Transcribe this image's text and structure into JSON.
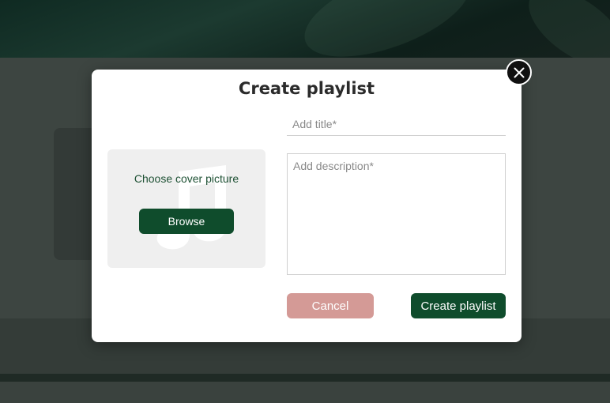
{
  "modal": {
    "title": "Create playlist",
    "cover": {
      "label": "Choose cover picture",
      "browse_label": "Browse",
      "icon": "music-note-icon"
    },
    "title_field": {
      "value": "",
      "placeholder": "Add title*"
    },
    "description_field": {
      "value": "",
      "placeholder": "Add description*"
    },
    "cancel_label": "Cancel",
    "create_label": "Create playlist",
    "close_icon": "close-icon"
  },
  "colors": {
    "primary": "#0f4c2c",
    "cancel": "#d49a96",
    "cover_bg": "#efefef",
    "close_bg": "#111111"
  }
}
